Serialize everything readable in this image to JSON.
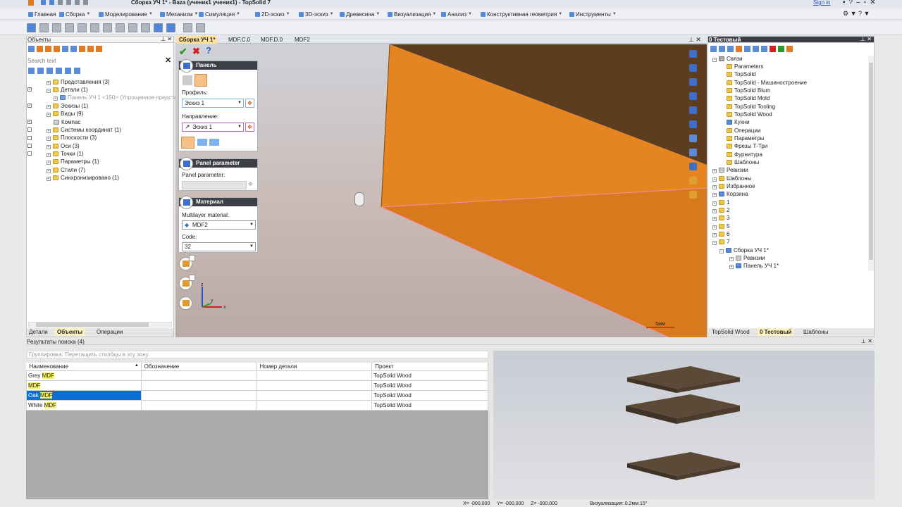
{
  "window": {
    "title": "Сборка УЧ 1* - Baza (ученик1 ученик1) - TopSolid 7",
    "signin": "Sign in"
  },
  "menu": [
    "Главная",
    "Сборка",
    "Моделирование",
    "Механизм",
    "Симуляция",
    "2D-эскиз",
    "3D-эскиз",
    "Древесина",
    "Визуализация",
    "Анализ",
    "Конструктивная геометрия",
    "Инструменты"
  ],
  "left_panel": {
    "title": "Объекты",
    "search_placeholder": "Search text",
    "items": [
      "Представления (3)",
      "Детали (1)",
      "Панель УЧ 1 <150> (Упрощенное предста",
      "Эскизы (1)",
      "Виды (9)",
      "Компас",
      "Системы координат (1)",
      "Плоскости (3)",
      "Оси (3)",
      "Точки (1)",
      "Параметры (1)",
      "Стили (7)",
      "Синхронизировано (1)"
    ],
    "tabs": [
      "Детали",
      "Объекты",
      "Операции"
    ]
  },
  "doc_tabs": [
    "Сборка УЧ 1*",
    "MDF.C.0",
    "MDF.D.0",
    "MDF2"
  ],
  "panel_section": {
    "title": "Панель",
    "profile_label": "Профиль:",
    "profile_value": "Эскиз 1",
    "direction_label": "Направление:",
    "direction_value": "Эскиз 1"
  },
  "param_section": {
    "title": "Panel parameter",
    "label": "Panel parameter:"
  },
  "material_section": {
    "title": "Материал",
    "ml_label": "Multilayer material:",
    "ml_value": "MDF2",
    "code_label": "Code:",
    "code_value": "32"
  },
  "scale_label": "5мм",
  "right_panel": {
    "title": "0 Тестовый",
    "items": [
      "Связи",
      "Parameters",
      "TopSolid",
      "TopSolid - Машиностроение",
      "TopSolid Blum",
      "TopSolid Mold",
      "TopSolid Tooling",
      "TopSolid Wood",
      "Кухни",
      "Операции",
      "Параметры",
      "Фрезы Т-Три",
      "Фурнитура",
      "Шаблоны",
      "Ревизии",
      "Шаблоны",
      "Избранное",
      "Корзина",
      "1",
      "2",
      "3",
      "5",
      "6",
      "7",
      "Сборка УЧ 1*",
      "Ревизии",
      "Панель УЧ 1*"
    ],
    "tabs": [
      "TopSolid Wood",
      "0 Тестовый",
      "Шаблоны"
    ]
  },
  "search_results": {
    "title": "Результаты поиска (4)",
    "group_hint": "Группировка: Перетащить столбцы в эту зону.",
    "columns": [
      "Наименование",
      "Обозначение",
      "Номер детали",
      "Проект"
    ],
    "rows": [
      {
        "prefix": "Grey ",
        "hit": "MDF",
        "project": "TopSolid Wood"
      },
      {
        "prefix": "",
        "hit": "MDF",
        "project": "TopSolid Wood"
      },
      {
        "prefix": "Oak ",
        "hit": "MDF",
        "project": "TopSolid Wood"
      },
      {
        "prefix": "White ",
        "hit": "MDF",
        "project": "TopSolid Wood"
      }
    ]
  },
  "status": {
    "x": "X= -000.000",
    "y": "Y= -000.000",
    "z": "Z= -000.000",
    "vis": "Визуализация: 0.2мм 15°"
  },
  "colors": {
    "panel_orange": "#e58521",
    "selection": "#0a6fd6",
    "highlight": "#f6f067"
  }
}
